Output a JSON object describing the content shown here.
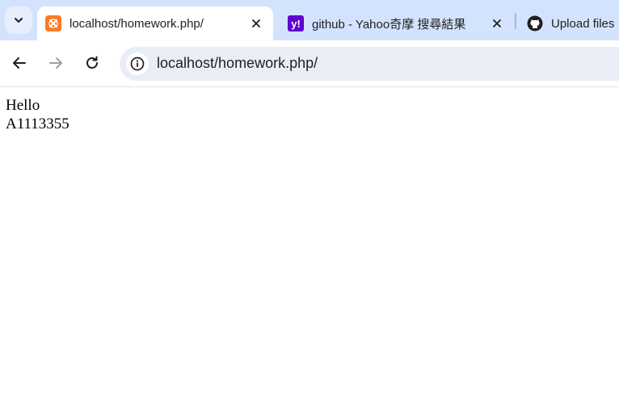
{
  "browser": {
    "tabs": [
      {
        "title": "localhost/homework.php/",
        "active": true,
        "favicon": "xampp-icon"
      },
      {
        "title": "github - Yahoo奇摩 搜尋結果",
        "active": false,
        "favicon": "yahoo-icon"
      },
      {
        "title": "Upload files",
        "active": false,
        "favicon": "github-icon"
      }
    ],
    "address_bar": {
      "url": "localhost/homework.php/"
    }
  },
  "page": {
    "lines": [
      "Hello",
      "A1113355"
    ]
  },
  "colors": {
    "tabstrip_bg": "#d3e3fd",
    "omnibox_bg": "#e9eef6",
    "xampp_orange": "#fb7a24",
    "yahoo_purple": "#6001d2"
  }
}
